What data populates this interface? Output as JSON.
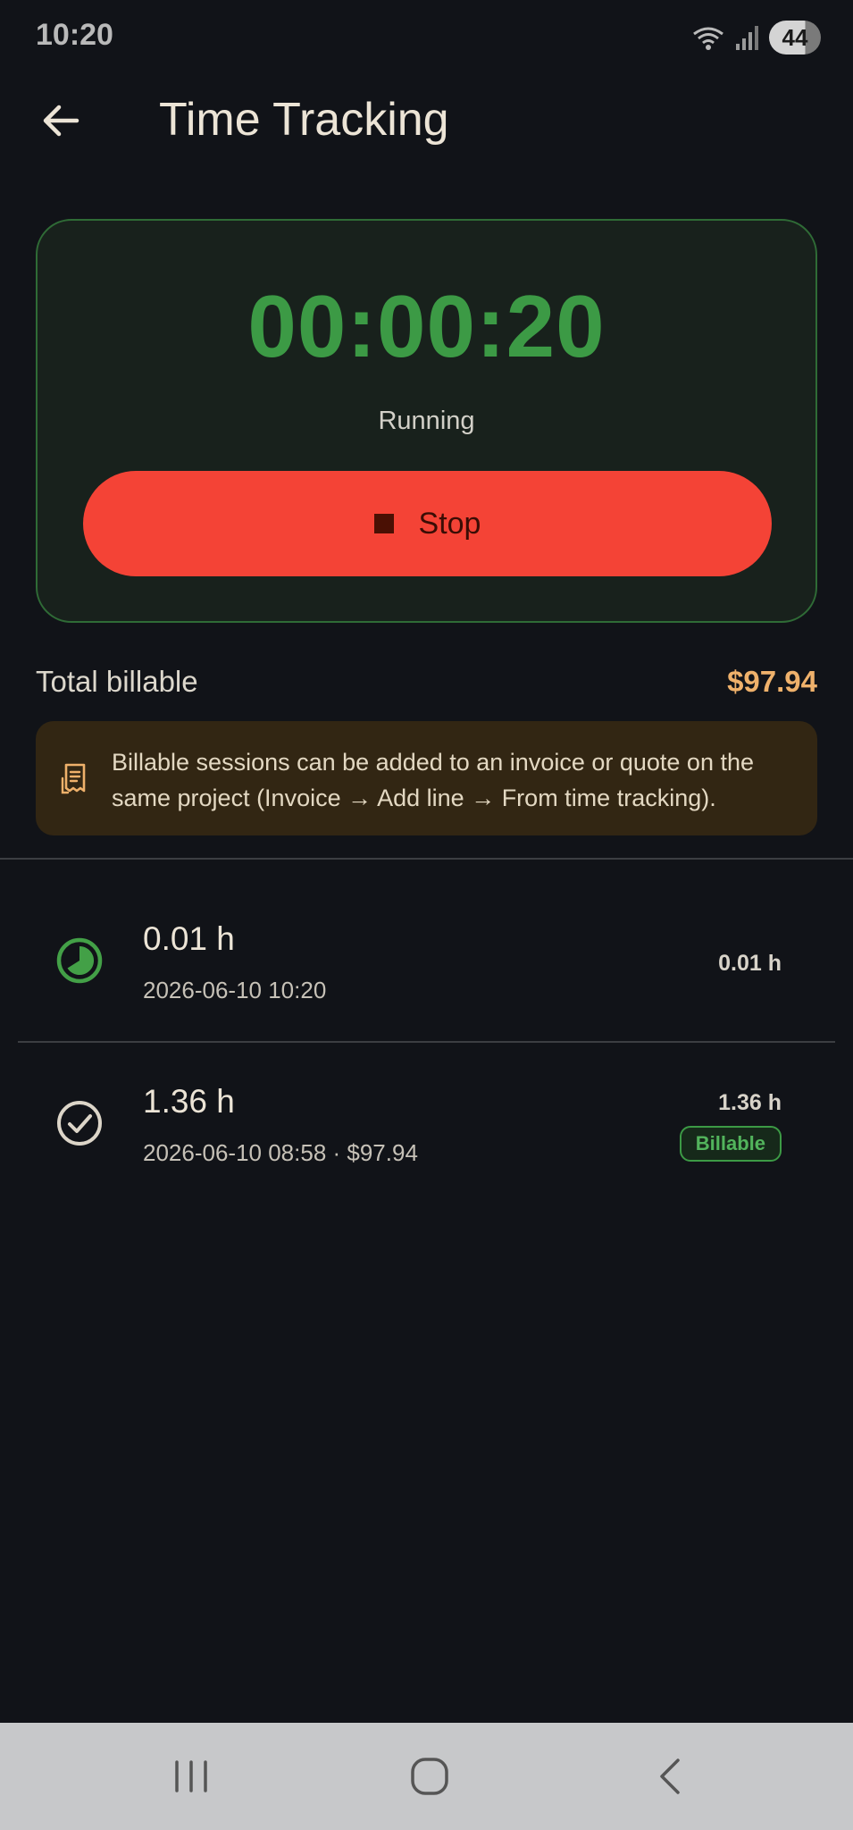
{
  "status_bar": {
    "time": "10:20",
    "battery": "44"
  },
  "app_bar": {
    "title": "Time Tracking"
  },
  "timer": {
    "value": "00:00:20",
    "status": "Running",
    "stop_label": "Stop"
  },
  "summary": {
    "label": "Total billable",
    "amount": "$97.94"
  },
  "info_banner": {
    "text": "Billable sessions can be added to an invoice or quote on the same project (Invoice → Add line → From time tracking)."
  },
  "sessions": [
    {
      "title": "0.01 h",
      "subtitle": "2026-06-10 10:20",
      "hours": "0.01 h",
      "icon": "running-timer-icon"
    },
    {
      "title": "1.36 h",
      "subtitle": "2026-06-10 08:58 · $97.94",
      "hours": "1.36 h",
      "badge": "Billable",
      "icon": "check-circle-icon"
    }
  ],
  "colors": {
    "accent_green": "#3c9a45",
    "stop_red": "#f44336",
    "amount_orange": "#efb16b",
    "background": "#111318"
  }
}
